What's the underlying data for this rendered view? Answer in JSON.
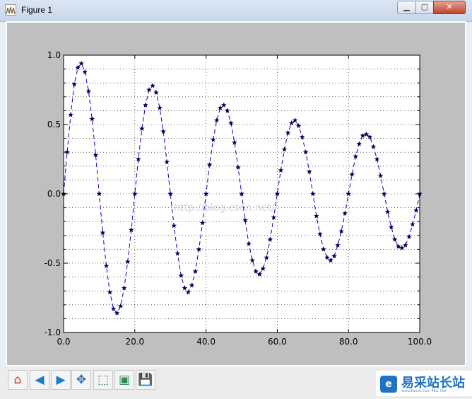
{
  "window": {
    "title": "Figure 1"
  },
  "window_buttons": {
    "minimize": "▁",
    "maximize": "▢",
    "close": "✕"
  },
  "toolbar": {
    "tools": [
      {
        "name": "home-icon",
        "glyph": "⌂"
      },
      {
        "name": "back-icon",
        "glyph": "◀"
      },
      {
        "name": "forward-icon",
        "glyph": "▶"
      },
      {
        "name": "pan-icon",
        "glyph": "✥"
      },
      {
        "name": "zoom-icon",
        "glyph": "⬚"
      },
      {
        "name": "subplots-icon",
        "glyph": "▣"
      },
      {
        "name": "save-icon",
        "glyph": "💾"
      }
    ]
  },
  "watermark": "http://blog.csdn.net/",
  "brand": {
    "text": "易采站长站",
    "sub": "www.Easck.Com 48u, Net"
  },
  "colors": {
    "line": "#0000cc",
    "marker": "#000055",
    "axes_bg": "#ffffff",
    "figure_bg": "#bfbfbf"
  },
  "chart_data": {
    "type": "line",
    "title": "",
    "xlabel": "",
    "ylabel": "",
    "xlim": [
      0,
      100
    ],
    "ylim": [
      -1.0,
      1.0
    ],
    "xticks": [
      "0.0",
      "20.0",
      "40.0",
      "60.0",
      "80.0",
      "100.0"
    ],
    "yticks": [
      "1.0",
      "0.5",
      "0.0",
      "-0.5",
      "-1.0"
    ],
    "grid": true,
    "line_style": "dashed",
    "marker": "star",
    "series": [
      {
        "x": [
          0,
          1,
          2,
          3,
          4,
          5,
          6,
          7,
          8,
          9,
          10,
          11,
          12,
          13,
          14,
          15,
          16,
          17,
          18,
          19,
          20,
          21,
          22,
          23,
          24,
          25,
          26,
          27,
          28,
          29,
          30,
          31,
          32,
          33,
          34,
          35,
          36,
          37,
          38,
          39,
          40,
          41,
          42,
          43,
          44,
          45,
          46,
          47,
          48,
          49,
          50,
          51,
          52,
          53,
          54,
          55,
          56,
          57,
          58,
          59,
          60,
          61,
          62,
          63,
          64,
          65,
          66,
          67,
          68,
          69,
          70,
          71,
          72,
          73,
          74,
          75,
          76,
          77,
          78,
          79,
          80,
          81,
          82,
          83,
          84,
          85,
          86,
          87,
          88,
          89,
          90,
          91,
          92,
          93,
          94,
          95,
          96,
          97,
          98,
          99,
          100
        ],
        "y": [
          0.0,
          0.3,
          0.57,
          0.79,
          0.91,
          0.94,
          0.88,
          0.74,
          0.54,
          0.28,
          0.0,
          -0.28,
          -0.52,
          -0.71,
          -0.83,
          -0.86,
          -0.81,
          -0.68,
          -0.49,
          -0.26,
          -0.0,
          0.25,
          0.47,
          0.64,
          0.75,
          0.78,
          0.73,
          0.62,
          0.45,
          0.23,
          0.0,
          -0.23,
          -0.43,
          -0.59,
          -0.68,
          -0.71,
          -0.66,
          -0.56,
          -0.4,
          -0.21,
          0.0,
          0.21,
          0.39,
          0.53,
          0.62,
          0.64,
          0.6,
          0.51,
          0.37,
          0.19,
          -0.0,
          -0.19,
          -0.36,
          -0.48,
          -0.56,
          -0.58,
          -0.54,
          -0.46,
          -0.33,
          -0.17,
          0.0,
          0.17,
          0.32,
          0.44,
          0.51,
          0.53,
          0.49,
          0.41,
          0.3,
          0.16,
          -0.0,
          -0.16,
          -0.29,
          -0.4,
          -0.46,
          -0.48,
          -0.45,
          -0.37,
          -0.27,
          -0.14,
          0.0,
          0.14,
          0.27,
          0.36,
          0.42,
          0.43,
          0.41,
          0.34,
          0.25,
          0.13,
          -0.0,
          -0.13,
          -0.24,
          -0.33,
          -0.38,
          -0.39,
          -0.37,
          -0.31,
          -0.22,
          -0.12,
          0.0
        ]
      }
    ]
  }
}
